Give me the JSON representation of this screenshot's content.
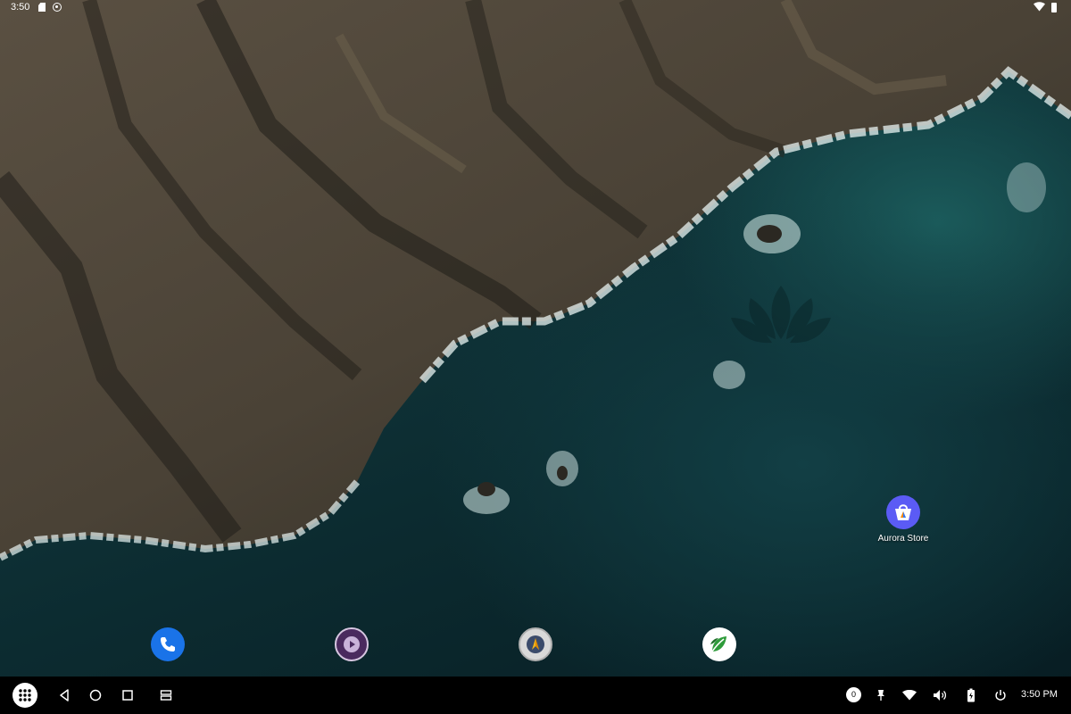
{
  "status_bar": {
    "time": "3:50",
    "icons": [
      "sd-card-icon",
      "sync-icon",
      "wifi-icon",
      "battery-icon"
    ]
  },
  "desktop": {
    "shortcuts": [
      {
        "label": "Aurora Store",
        "icon": "aurora-store-icon",
        "color": "#5b5bf5"
      }
    ]
  },
  "dock": {
    "apps": [
      {
        "icon": "phone-icon",
        "color": "#1a73e8"
      },
      {
        "icon": "media-player-icon",
        "color": "#5b2d6e"
      },
      {
        "icon": "migration-app-icon",
        "color": "#d9d9d9"
      },
      {
        "icon": "green-leaf-app-icon",
        "color": "#ffffff"
      }
    ]
  },
  "taskbar": {
    "notification_count": "0",
    "clock": "3:50 PM",
    "nav": [
      "apps-grid-icon",
      "back-icon",
      "home-icon",
      "recents-icon",
      "split-window-icon"
    ],
    "tray": [
      "pin-icon",
      "wifi-icon",
      "volume-icon",
      "battery-icon",
      "power-icon"
    ]
  }
}
